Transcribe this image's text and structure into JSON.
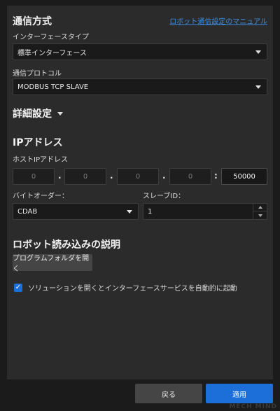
{
  "comm": {
    "title": "通信方式",
    "manual_link": "ロボット通信設定のマニュアル",
    "interface_type_label": "インターフェースタイプ",
    "interface_type_value": "標準インターフェース",
    "protocol_label": "通信プロトコル",
    "protocol_value": "MODBUS TCP SLAVE"
  },
  "advanced": {
    "title": "詳細設定"
  },
  "ip": {
    "title": "IPアドレス",
    "host_label": "ホストIPアドレス",
    "octets": [
      "0",
      "0",
      "0",
      "0"
    ],
    "sep_dot": ".",
    "sep_colon": ":",
    "port": "50000",
    "byte_order_label": "バイトオーダー：",
    "byte_order_value": "CDAB",
    "slave_id_label": "スレーブID：",
    "slave_id_value": "1"
  },
  "robot_load": {
    "title": "ロボット読み込みの説明",
    "open_folder_button": "プログラムフォルダを開く",
    "checkbox_label": "ソリューションを開くとインターフェースサービスを自動的に起動",
    "checkbox_checked": true
  },
  "footer": {
    "back_button": "戻る",
    "apply_button": "適用"
  },
  "watermark": "MECH MIND",
  "colors": {
    "accent": "#1c6fd8",
    "link": "#3d8ee0",
    "panel": "#2b2b2b",
    "background": "#1b1b1b"
  }
}
